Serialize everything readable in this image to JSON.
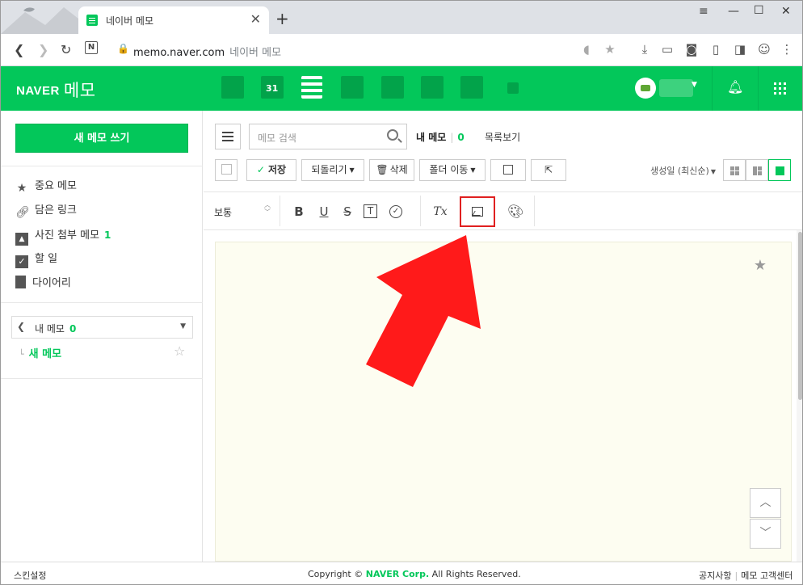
{
  "browser": {
    "tab_title": "네이버 메모",
    "tab_close": "✕",
    "new_tab": "+",
    "url": "memo.naver.com",
    "page_title_suffix": "네이버 메모"
  },
  "header": {
    "brand": "NAVER",
    "brand_sub": "메모",
    "services": [
      "mail-icon",
      "calendar-icon",
      "memo-list-icon",
      "contacts-icon",
      "mybox-icon",
      "office-icon",
      "pay-icon",
      "more-icon"
    ],
    "calendar_number": "31"
  },
  "sidebar": {
    "new_memo_label": "새 메모 쓰기",
    "items": [
      {
        "label": "중요 메모",
        "icon": "star-icon"
      },
      {
        "label": "담은 링크",
        "icon": "link-icon"
      },
      {
        "label": "사진 첨부 메모",
        "icon": "photo-icon",
        "count": "1"
      },
      {
        "label": "할 일",
        "icon": "checkbox-icon"
      },
      {
        "label": "다이어리",
        "icon": "diary-icon"
      }
    ],
    "folder_select": {
      "label": "내 메모",
      "count": "0"
    },
    "current_memo": "새 메모"
  },
  "toolbar": {
    "search_placeholder": "메모 검색",
    "my_memo_label": "내 메모",
    "my_memo_count": "0",
    "list_view_label": "목록보기",
    "save_label": "저장",
    "revert_label": "되돌리기",
    "delete_label": "삭제",
    "move_folder_label": "폴더 이동",
    "sort_label": "생성일 (최신순)"
  },
  "format_bar": {
    "font_size": "보통",
    "bold": "B",
    "underline": "U",
    "strike": "S",
    "text_style": "T",
    "clear_format": "Tx"
  },
  "footer": {
    "skin_settings": "스킨설정",
    "copyright_prefix": "Copyright ©",
    "copyright_company": "NAVER Corp.",
    "copyright_suffix": "All Rights Reserved.",
    "notice": "공지사항",
    "support": "메모 고객센터"
  },
  "colors": {
    "naver_green": "#03c75a",
    "annotation_red": "#ff1a1a"
  }
}
